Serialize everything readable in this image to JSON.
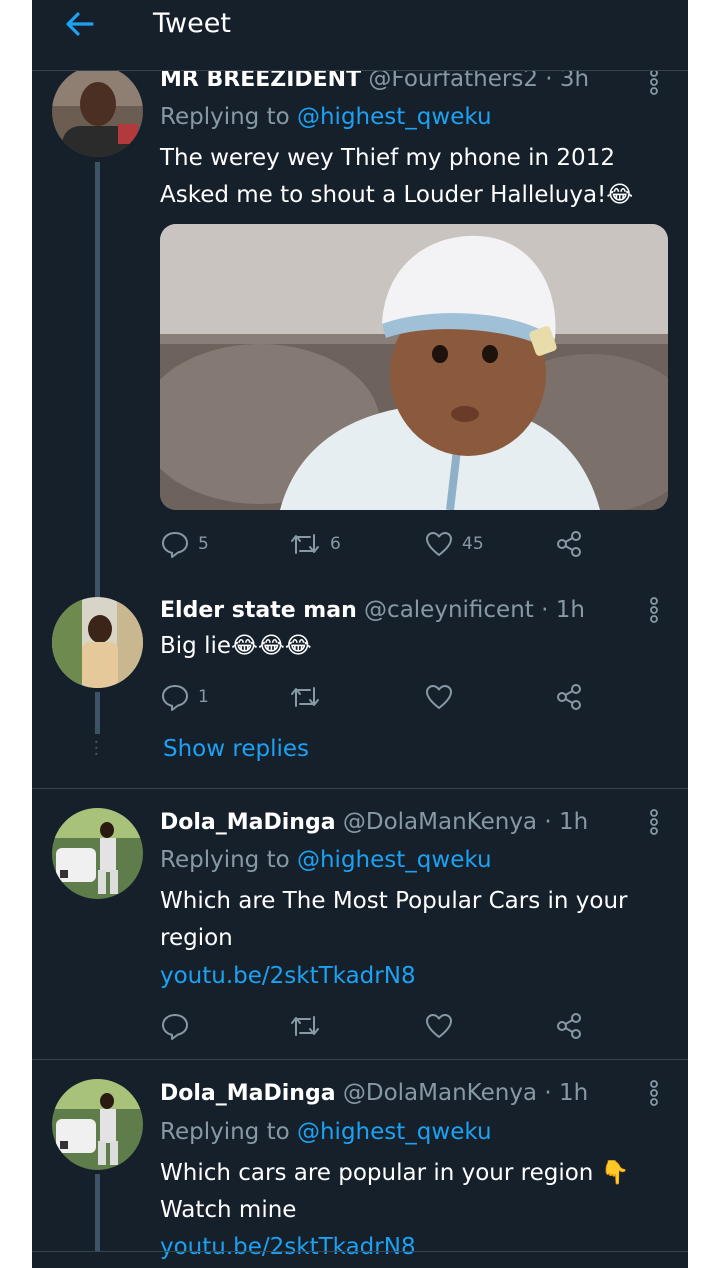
{
  "header": {
    "title": "Tweet"
  },
  "tweets": [
    {
      "name": "MR BREEZIDENT",
      "handle": "@Fourfathers2",
      "time": "· 3h",
      "replying_prefix": "Replying to ",
      "replying_to": "@highest_qweku",
      "body_line1": "The werey wey Thief my phone in 2012",
      "body_line2": "Asked me to shout a Louder Halleluya!😂",
      "replies": "5",
      "retweets": "6",
      "likes": "45"
    },
    {
      "name": "Elder state man",
      "handle": "@caleynificent",
      "time": "· 1h",
      "body_line1": "Big lie😂😂😂",
      "replies": "1",
      "show_replies": "Show replies"
    },
    {
      "name": "Dola_MaDinga",
      "handle": "@DolaManKenya",
      "time": "· 1h",
      "replying_prefix": "Replying to ",
      "replying_to": "@highest_qweku",
      "body_line1": "Which are The Most Popular Cars in your",
      "body_line2": "region",
      "link": "youtu.be/2sktTkadrN8"
    },
    {
      "name": "Dola_MaDinga",
      "handle": "@DolaManKenya",
      "time": "· 1h",
      "replying_prefix": "Replying to ",
      "replying_to": "@highest_qweku",
      "body_line1": "Which cars are popular in your region 👇",
      "body_line2": "Watch mine",
      "link": "youtu.be/2sktTkadrN8"
    }
  ],
  "colors": {
    "background": "#15202b",
    "accent": "#1da1f2",
    "secondary_text": "#8899a6",
    "divider": "#38444d"
  },
  "icons": {
    "back": "arrow-left-icon",
    "more": "vertical-dots-icon",
    "reply": "speech-bubble-icon",
    "retweet": "retweet-icon",
    "like": "heart-icon",
    "share": "share-icon"
  }
}
